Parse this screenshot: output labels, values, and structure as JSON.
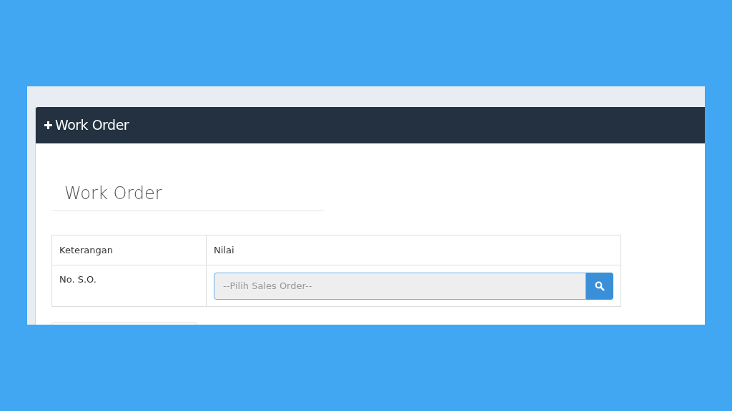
{
  "panel": {
    "title": "Work Order"
  },
  "section_title": "Work Order",
  "table": {
    "columns": [
      "Keterangan",
      "Nilai"
    ],
    "rows": [
      {
        "label": "No. S.O.",
        "field": {
          "placeholder": "--Pilih Sales Order--"
        }
      }
    ]
  }
}
